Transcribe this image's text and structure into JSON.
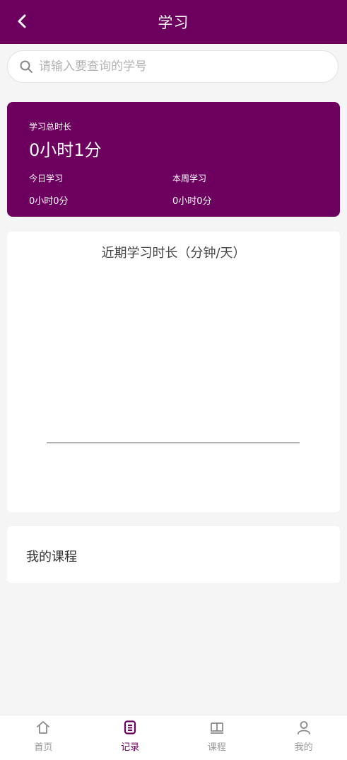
{
  "header": {
    "title": "学习",
    "back_icon": "chevron-left-icon"
  },
  "search": {
    "placeholder": "请输入要查询的学号",
    "value": ""
  },
  "stats": {
    "total_label": "学习总时长",
    "total_value": "0小时1分",
    "today_label": "今日学习",
    "today_value": "0小时0分",
    "week_label": "本周学习",
    "week_value": "0小时0分"
  },
  "chart": {
    "title": "近期学习时长（分钟/天）"
  },
  "chart_data": {
    "type": "line",
    "title": "近期学习时长（分钟/天）",
    "categories": [],
    "series": [],
    "xlabel": "",
    "ylabel": ""
  },
  "courses": {
    "label": "我的课程"
  },
  "tabbar": {
    "items": [
      {
        "label": "首页",
        "icon": "home-icon",
        "active": false
      },
      {
        "label": "记录",
        "icon": "record-icon",
        "active": true
      },
      {
        "label": "课程",
        "icon": "book-icon",
        "active": false
      },
      {
        "label": "我的",
        "icon": "user-icon",
        "active": false
      }
    ]
  },
  "colors": {
    "primary": "#6d005f",
    "background": "#f5f5f5",
    "inactive": "#999999"
  }
}
